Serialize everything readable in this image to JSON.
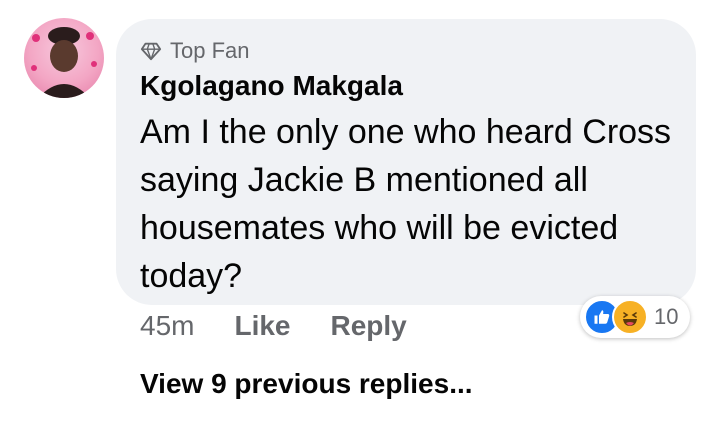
{
  "comment": {
    "badge": "Top Fan",
    "author": "Kgolagano Makgala",
    "text": "Am I the only one who heard Cross saying Jackie B mentioned all housemates who will be evicted today?",
    "time": "45m",
    "like_label": "Like",
    "reply_label": "Reply",
    "reactions": {
      "icons": [
        "like-icon",
        "haha-icon"
      ],
      "count": "10"
    }
  },
  "view_replies_label": "View 9 previous replies...",
  "colors": {
    "bubble": "#f0f2f5",
    "text": "#050505",
    "muted": "#65676b",
    "like_blue": "#1877f2",
    "haha_yellow": "#f7b125"
  }
}
